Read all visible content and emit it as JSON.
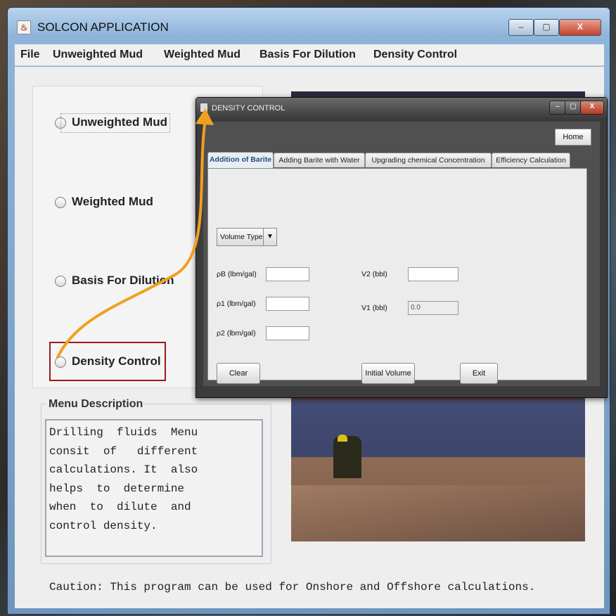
{
  "main_window": {
    "title": "SOLCON APPLICATION",
    "controls": {
      "minimize": "–",
      "maximize": "▢",
      "close": "X"
    }
  },
  "menubar": [
    "File",
    "Unweighted Mud",
    "Weighted Mud",
    "Basis For Dilution",
    "Density Control"
  ],
  "radios": [
    {
      "label": "Unweighted Mud"
    },
    {
      "label": "Weighted Mud"
    },
    {
      "label": "Basis For Dilution"
    },
    {
      "label": "Density Control"
    }
  ],
  "menu_description": {
    "title": "Menu Description",
    "text": "Drilling  fluids  Menu\nconsit  of   different\ncalculations. It  also\nhelps  to  determine\nwhen  to  dilute  and\ncontrol density."
  },
  "caution": "Caution: This program can be used for Onshore and Offshore calculations.",
  "dialog": {
    "title": "DENSITY CONTROL",
    "controls": {
      "minimize": "–",
      "maximize": "▢",
      "close": "X"
    },
    "home_label": "Home",
    "tabs": [
      "Addition of Barite",
      "Adding Barite with Water",
      "Upgrading chemical Concentration",
      "Efficiency Calculation"
    ],
    "combo_label": "Volume Type",
    "fields": {
      "rhoB_label": "ρB (lbm/gal)",
      "rho1_label": "ρ1 (lbm/gal)",
      "rho2_label": "ρ2 (lbm/gal)",
      "v2_label": "V2 (bbl)",
      "v1_label": "V1 (bbl)",
      "v1_value": "0.0"
    },
    "buttons": {
      "clear": "Clear",
      "initial_volume": "Initial Volume",
      "exit": "Exit"
    }
  },
  "colors": {
    "highlight_border": "#9b1a1a",
    "arrow": "#f0a020",
    "active_tab_text": "#2a4a78"
  }
}
